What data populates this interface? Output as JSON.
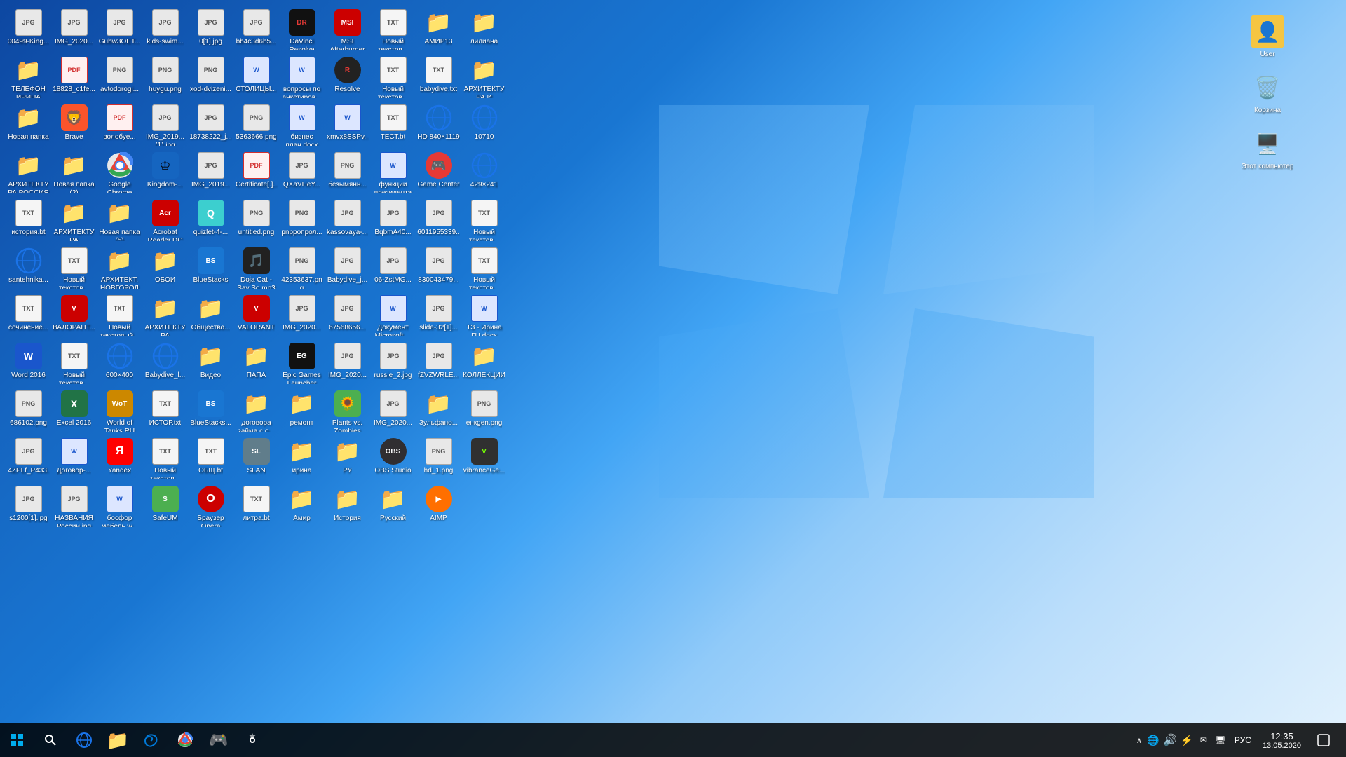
{
  "desktop": {
    "background": "Windows 10 blue desktop",
    "icons": [
      {
        "id": "00499",
        "label": "00499-King...",
        "type": "jpg"
      },
      {
        "id": "IMG_20200",
        "label": "IMG_2020...",
        "type": "jpg"
      },
      {
        "id": "Gubw3OET",
        "label": "Gubw3OET...",
        "type": "jpg"
      },
      {
        "id": "kids-swim",
        "label": "kids-swim...",
        "type": "jpg"
      },
      {
        "id": "0[1]",
        "label": "0[1].jpg",
        "type": "jpg"
      },
      {
        "id": "bb4c3d6b5",
        "label": "bb4c3d6b5...",
        "type": "jpg"
      },
      {
        "id": "DaVinci",
        "label": "DaVinci Resolve Pro...",
        "type": "app"
      },
      {
        "id": "MSI",
        "label": "MSI Afterburner",
        "type": "app"
      },
      {
        "id": "Noviy1",
        "label": "Новый текстов...",
        "type": "txt"
      },
      {
        "id": "AMIR13",
        "label": "АМИР13",
        "type": "folder"
      },
      {
        "id": "liliana",
        "label": "лилиана",
        "type": "folder"
      },
      {
        "id": "TELEFON",
        "label": "ТЕЛЕФОН ИРИНА",
        "type": "folder"
      },
      {
        "id": "18828_c1fe",
        "label": "18828_c1fe...",
        "type": "pdf"
      },
      {
        "id": "avtodorogi",
        "label": "avtodorogi...",
        "type": "png"
      },
      {
        "id": "huygu",
        "label": "huygu.png",
        "type": "png"
      },
      {
        "id": "xod-dvizeni",
        "label": "xod-dvizeni...",
        "type": "png"
      },
      {
        "id": "STOLICY",
        "label": "СТОЛИЦЫ...",
        "type": "docx"
      },
      {
        "id": "voprosy",
        "label": "вопросы по анкетиров...",
        "type": "docx"
      },
      {
        "id": "Resolve",
        "label": "Resolve",
        "type": "app"
      },
      {
        "id": "Noviy2",
        "label": "Новый текстов...",
        "type": "txt"
      },
      {
        "id": "babydive",
        "label": "babydive.txt",
        "type": "txt"
      },
      {
        "id": "ARHIT1",
        "label": "АРХИТЕКТУРА И СКУЛЬП...",
        "type": "folder"
      },
      {
        "id": "NovayaP",
        "label": "Новая папка",
        "type": "folder"
      },
      {
        "id": "Brave",
        "label": "Brave",
        "type": "app"
      },
      {
        "id": "volobye",
        "label": "волобуе...",
        "type": "pdf"
      },
      {
        "id": "IMG_20190_1",
        "label": "IMG_2019... (1).jpg",
        "type": "jpg"
      },
      {
        "id": "18738222",
        "label": "18738222_j...",
        "type": "jpg"
      },
      {
        "id": "5363666",
        "label": "5363666.png",
        "type": "png"
      },
      {
        "id": "biznes",
        "label": "бизнес план.docx",
        "type": "docx"
      },
      {
        "id": "xmvx8SSPv",
        "label": "xmvx8SSPv...",
        "type": "docx"
      },
      {
        "id": "TEST",
        "label": "ТЕСТ.bt",
        "type": "txt"
      },
      {
        "id": "HD840",
        "label": "HD 840×1119",
        "type": "app"
      },
      {
        "id": "10710",
        "label": "10710",
        "type": "app"
      },
      {
        "id": "ARHIT_RUSSIA",
        "label": "АРХИТЕКТУРА РОССИЯ И...",
        "type": "folder"
      },
      {
        "id": "NovayaP2",
        "label": "Новая папка (2)",
        "type": "folder"
      },
      {
        "id": "GoogleChrome",
        "label": "Google Chrome",
        "type": "app"
      },
      {
        "id": "Kingdom",
        "label": "Kingdom-...",
        "type": "app"
      },
      {
        "id": "IMG_20190_2",
        "label": "IMG_2019...",
        "type": "jpg"
      },
      {
        "id": "Certificate",
        "label": "Certificate[.]...",
        "type": "pdf"
      },
      {
        "id": "QXaVHeY",
        "label": "QXaVHeY...",
        "type": "jpg"
      },
      {
        "id": "bezymyan",
        "label": "безымянн...",
        "type": "png"
      },
      {
        "id": "funkcii",
        "label": "функции президента",
        "type": "docx"
      },
      {
        "id": "GameCenter",
        "label": "Game Center",
        "type": "app"
      },
      {
        "id": "IE1",
        "label": "429×241",
        "type": "app"
      },
      {
        "id": "istoriya",
        "label": "история.bt",
        "type": "txt"
      },
      {
        "id": "ARHIT_VLAD",
        "label": "АРХИТЕКТУРА ВЛАДИМИР",
        "type": "folder"
      },
      {
        "id": "NovayaP5",
        "label": "Новая папка (5)",
        "type": "folder"
      },
      {
        "id": "AcrobatDC",
        "label": "Acrobat Reader DC",
        "type": "app"
      },
      {
        "id": "quizlet",
        "label": "quizlet-4-...",
        "type": "app"
      },
      {
        "id": "untitled",
        "label": "untitled.png",
        "type": "png"
      },
      {
        "id": "pnproprol",
        "label": "pnpропрол...",
        "type": "png"
      },
      {
        "id": "kassovaya",
        "label": "kassovaya-...",
        "type": "jpg"
      },
      {
        "id": "BqbmA40",
        "label": "BqbmA40...",
        "type": "jpg"
      },
      {
        "id": "6011955339",
        "label": "6011955339...",
        "type": "jpg"
      },
      {
        "id": "Noviy3",
        "label": "Новый текстов...",
        "type": "txt"
      },
      {
        "id": "santehnika",
        "label": "santehnika...",
        "type": "app"
      },
      {
        "id": "Noviy4",
        "label": "Новый текстов...",
        "type": "txt"
      },
      {
        "id": "ARHIT_NOVG",
        "label": "АРХИТЕКТ. НОВГОРОД",
        "type": "folder"
      },
      {
        "id": "OBOI",
        "label": "ОБОИ",
        "type": "folder"
      },
      {
        "id": "BlueStacks",
        "label": "BlueStacks",
        "type": "app"
      },
      {
        "id": "DojaCat",
        "label": "Doja Cat - Say So.mp3",
        "type": "mp3"
      },
      {
        "id": "42353637",
        "label": "42353637.png",
        "type": "png"
      },
      {
        "id": "Babydive_j",
        "label": "Babydive_j...",
        "type": "jpg"
      },
      {
        "id": "06-Zst",
        "label": "06-ZstMG...",
        "type": "jpg"
      },
      {
        "id": "830043479",
        "label": "830043479...",
        "type": "jpg"
      },
      {
        "id": "Noviy5",
        "label": "Новый текстов...",
        "type": "txt"
      },
      {
        "id": "sochinenie",
        "label": "сочинение...",
        "type": "txt"
      },
      {
        "id": "VALORANT",
        "label": "ВАЛОРАНТ...",
        "type": "app"
      },
      {
        "id": "Noviy6",
        "label": "Новый текстовый...",
        "type": "txt"
      },
      {
        "id": "ARHIT_SKUL",
        "label": "АРХИТЕКТУРА СКУЛЬПТУ...",
        "type": "folder"
      },
      {
        "id": "Obshchestvo",
        "label": "Общество...",
        "type": "folder"
      },
      {
        "id": "VALORANT_ico",
        "label": "VALORANT",
        "type": "app"
      },
      {
        "id": "IMG_20200_2",
        "label": "IMG_2020...",
        "type": "jpg"
      },
      {
        "id": "67568656",
        "label": "67568656...",
        "type": "jpg"
      },
      {
        "id": "DokMicrosoft",
        "label": "Документ Microsoft ...",
        "type": "docx"
      },
      {
        "id": "slide32",
        "label": "slide-32[1]...",
        "type": "jpg"
      },
      {
        "id": "TZ_Irina",
        "label": "ТЗ - Ирина ГЦ.docx",
        "type": "docx"
      },
      {
        "id": "Word2016",
        "label": "Word 2016",
        "type": "app"
      },
      {
        "id": "Noviy7",
        "label": "Новый текстов...",
        "type": "txt"
      },
      {
        "id": "IE600",
        "label": "600×400",
        "type": "app"
      },
      {
        "id": "Babydive_l",
        "label": "Babydive_l...",
        "type": "app"
      },
      {
        "id": "Video",
        "label": "Видео",
        "type": "folder"
      },
      {
        "id": "PAPA",
        "label": "ПАПА",
        "type": "folder"
      },
      {
        "id": "EpicGames",
        "label": "Epic Games Launcher",
        "type": "app"
      },
      {
        "id": "IMG_20200_3",
        "label": "IMG_2020...",
        "type": "jpg"
      },
      {
        "id": "russie2",
        "label": "russie_2.jpg",
        "type": "jpg"
      },
      {
        "id": "fZVZWRLE",
        "label": "fZVZWRLE...",
        "type": "jpg"
      },
      {
        "id": "KOLLEKCII",
        "label": "КОЛЛЕКЦИИ...",
        "type": "folder"
      },
      {
        "id": "686102",
        "label": "686102.png",
        "type": "png"
      },
      {
        "id": "Excel2016",
        "label": "Excel 2016",
        "type": "app"
      },
      {
        "id": "WoT",
        "label": "World of Tanks RU",
        "type": "app"
      },
      {
        "id": "ISTOR",
        "label": "ИСТОР.txt",
        "type": "txt"
      },
      {
        "id": "BlueStacks_2",
        "label": "BlueStacks...",
        "type": "app"
      },
      {
        "id": "dogovor",
        "label": "договора займа с о...",
        "type": "folder"
      },
      {
        "id": "remont",
        "label": "ремонт",
        "type": "folder"
      },
      {
        "id": "PlantsZombies",
        "label": "Plants vs. Zombies",
        "type": "app"
      },
      {
        "id": "IMG_20200_4",
        "label": "IMG_2020...",
        "type": "jpg"
      },
      {
        "id": "Zulfano",
        "label": "Зульфано...",
        "type": "folder"
      },
      {
        "id": "enkgen",
        "label": "енкgen.png",
        "type": "png"
      },
      {
        "id": "4ZPLf",
        "label": "4ZPLf_P433...",
        "type": "jpg"
      },
      {
        "id": "Dogovor_R",
        "label": "Договор-...",
        "type": "docx"
      },
      {
        "id": "Yandex",
        "label": "Yandex",
        "type": "app"
      },
      {
        "id": "Noviy8",
        "label": "Новый текстов...",
        "type": "txt"
      },
      {
        "id": "OBSH",
        "label": "ОБЩ.bt",
        "type": "txt"
      },
      {
        "id": "SLAN",
        "label": "SLAN",
        "type": "app"
      },
      {
        "id": "irina",
        "label": "ирина",
        "type": "folder"
      },
      {
        "id": "RU",
        "label": "РУ",
        "type": "folder"
      },
      {
        "id": "OBSStudio",
        "label": "OBS Studio",
        "type": "app"
      },
      {
        "id": "hd1",
        "label": "hd_1.png",
        "type": "png"
      },
      {
        "id": "vibranceGe",
        "label": "vibranceGe...",
        "type": "app"
      },
      {
        "id": "s1200",
        "label": "s1200[1].jpg",
        "type": "jpg"
      },
      {
        "id": "NAZVANIYA",
        "label": "НАЗВАНИЯ России.jpg",
        "type": "jpg"
      },
      {
        "id": "bosfor",
        "label": "босфор мебель.w...",
        "type": "docx"
      },
      {
        "id": "SafeUM",
        "label": "SafeUM",
        "type": "app"
      },
      {
        "id": "Opera",
        "label": "Браузер Opera",
        "type": "app"
      },
      {
        "id": "litra",
        "label": "литра.bt",
        "type": "txt"
      },
      {
        "id": "Amir",
        "label": "Амир",
        "type": "folder"
      },
      {
        "id": "Istoriya_f",
        "label": "История",
        "type": "folder"
      },
      {
        "id": "Russkiy",
        "label": "Русский",
        "type": "folder"
      },
      {
        "id": "AIMP",
        "label": "AIMP",
        "type": "app"
      }
    ],
    "right_icons": [
      {
        "id": "User",
        "label": "User",
        "type": "folder_user"
      },
      {
        "id": "Korzina",
        "label": "Корзина",
        "type": "recycle"
      },
      {
        "id": "EtoKomp",
        "label": "Этот компьютер",
        "type": "computer"
      }
    ]
  },
  "taskbar": {
    "time": "12:35",
    "date": "13.05.2020",
    "language": "РУС",
    "start_label": "Start",
    "search_label": "Search",
    "pinned": [
      "IE",
      "Explorer",
      "Chrome",
      "Steam",
      "Settings"
    ]
  }
}
